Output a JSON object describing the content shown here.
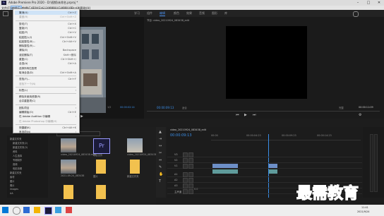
{
  "window": {
    "title": "Adobe Premiere Pro 2020 - D:\\视频\\未命名.prproj *",
    "controls": [
      "–",
      "□",
      "✕"
    ],
    "app_badge": "Pr"
  },
  "menubar": [
    "文件(F)",
    "编辑(E)",
    "剪辑(C)",
    "序列(S)",
    "标记(M)",
    "图形(G)",
    "视图(V)",
    "窗口(W)",
    "帮助(H)"
  ],
  "workspaces": [
    "学习",
    "组件",
    "编辑",
    "颜色",
    "效果",
    "音频",
    "图形",
    "库"
  ],
  "edit_menu": {
    "items": [
      {
        "label": "撤消(U)",
        "shortcut": "Ctrl+Z",
        "disabled": false,
        "highlight": true
      },
      {
        "label": "重做(R)",
        "shortcut": "Ctrl+Shift+Z",
        "disabled": true
      },
      {
        "sep": true
      },
      {
        "label": "剪切(T)",
        "shortcut": "Ctrl+X",
        "disabled": false
      },
      {
        "label": "复制(Y)",
        "shortcut": "Ctrl+C",
        "disabled": false
      },
      {
        "label": "粘贴(P)",
        "shortcut": "Ctrl+V",
        "disabled": false
      },
      {
        "label": "粘贴插入(I)",
        "shortcut": "Ctrl+Shift+V",
        "disabled": false
      },
      {
        "label": "粘贴属性(B)...",
        "shortcut": "Ctrl+Alt+V",
        "disabled": false
      },
      {
        "label": "删除属性(R)...",
        "shortcut": "",
        "disabled": false
      },
      {
        "label": "清除(E)",
        "shortcut": "Backspace",
        "disabled": false
      },
      {
        "label": "波纹删除(T)",
        "shortcut": "Shift+删除",
        "disabled": false
      },
      {
        "label": "重复(C)",
        "shortcut": "Ctrl+Shift+/",
        "disabled": false
      },
      {
        "label": "全选(A)",
        "shortcut": "Ctrl+A",
        "disabled": false
      },
      {
        "label": "选择所有匹配项",
        "shortcut": "",
        "disabled": false
      },
      {
        "label": "取消全选(D)",
        "shortcut": "Ctrl+Shift+A",
        "disabled": false
      },
      {
        "sep": true
      },
      {
        "label": "查找(F)...",
        "shortcut": "Ctrl+F",
        "disabled": false
      },
      {
        "label": "查找下一个(N)",
        "shortcut": "",
        "disabled": true
      },
      {
        "sep": true
      },
      {
        "label": "标签(L)",
        "shortcut": "›",
        "disabled": false
      },
      {
        "sep": true
      },
      {
        "label": "移除未使用资源(R)",
        "shortcut": "",
        "disabled": false
      },
      {
        "label": "合并重复项(C)",
        "shortcut": "",
        "disabled": false
      },
      {
        "sep": true
      },
      {
        "label": "团队项目",
        "shortcut": "›",
        "disabled": false
      },
      {
        "label": "编辑原始(O)",
        "shortcut": "Ctrl+E",
        "disabled": false
      },
      {
        "label": "在 Adobe Audition 中编辑",
        "shortcut": "›",
        "disabled": false
      },
      {
        "label": "在 Adobe Photoshop 中编辑(H)",
        "shortcut": "",
        "disabled": true
      },
      {
        "sep": true
      },
      {
        "label": "快捷键(K)",
        "shortcut": "Ctrl+Alt+K",
        "disabled": false
      },
      {
        "label": "首选项(N)",
        "shortcut": "›",
        "disabled": false
      }
    ]
  },
  "source_monitor": {
    "timecode": "00:00:02:14",
    "zoom": "1/2"
  },
  "program_monitor": {
    "tab": "节目: video_20210924_083438_edit",
    "timecode": "00:00:09:13",
    "fit": "适合",
    "quality": "完整",
    "duration": "00:00:11:09"
  },
  "project_panel": {
    "title": "项目:未命名",
    "search_placeholder": "",
    "tree": [
      "新建文件夹",
      "新建文件夹(2)",
      "新建文件夹(3)",
      "资料",
      "人生选择",
      "专辑制作",
      "音频",
      "电影剪辑",
      "新建文件夹",
      "素材",
      "图片",
      "照片",
      "images",
      "AA"
    ],
    "items": [
      {
        "label": "video_20210924_083438.mp4",
        "kind": "video"
      },
      {
        "label": "项目文件",
        "kind": "pr"
      },
      {
        "label": "video_20210924_083438_edit",
        "kind": "seq"
      },
      {
        "label": "2021-09-24_083438",
        "kind": "photo"
      },
      {
        "label": "图片",
        "kind": "folder"
      },
      {
        "label": "新建文件夹",
        "kind": "folder"
      },
      {
        "label": "",
        "kind": "folder"
      },
      {
        "label": "",
        "kind": "folder"
      }
    ]
  },
  "timeline": {
    "tab": "video_20210924_083438_edit",
    "timecode": "00:00:09:13",
    "ruler": [
      "00:00",
      "00:00:04:23",
      "00:00:09:23",
      "00:00:14:23"
    ],
    "tracks": [
      "V3",
      "V2",
      "V1",
      "A1",
      "A2",
      "A3",
      "主声道"
    ],
    "master_value": "0.0"
  },
  "taskbar": {
    "time": "11:41",
    "date": "2021/9/24"
  },
  "watermark": "最需教育",
  "colors": {
    "accent": "#3a8ee8",
    "pr_purple": "#9999ff",
    "clip_video": "#6d8fc7",
    "clip_audio": "#5f9b9b"
  }
}
